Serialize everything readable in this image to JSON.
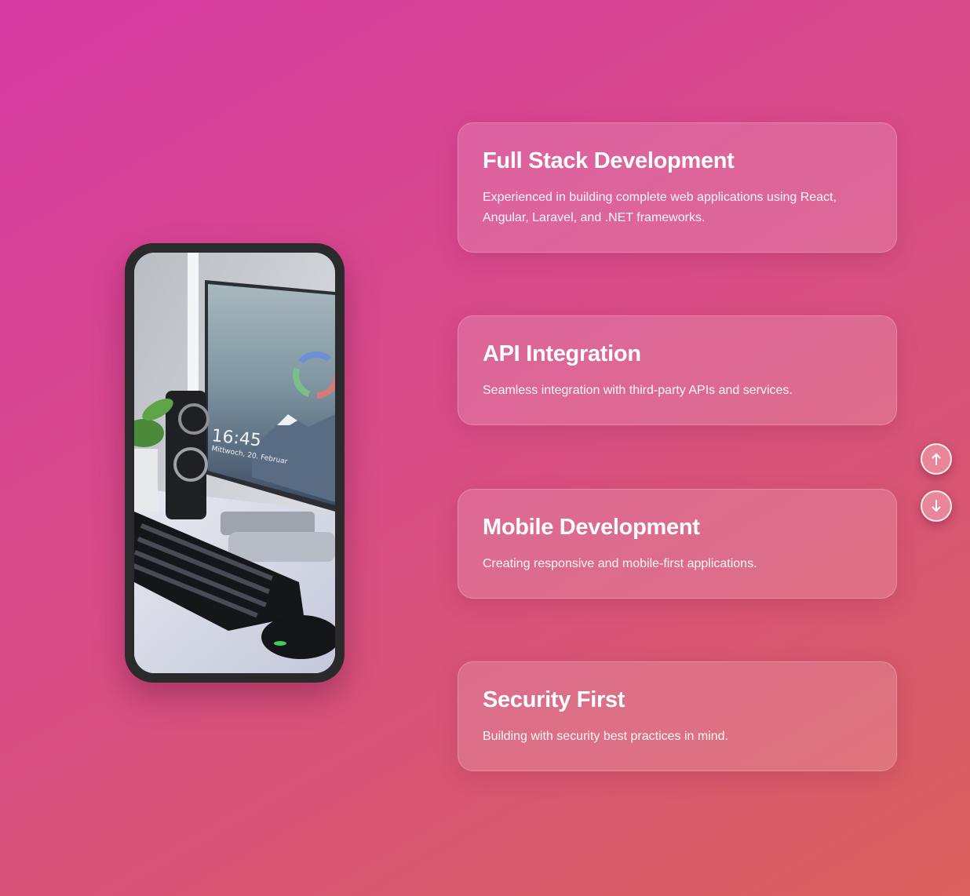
{
  "phone": {
    "image_description_icon": "desk-setup-photo",
    "clock_time": "16:45",
    "clock_date": "Mittwoch, 20. Februar"
  },
  "cards": [
    {
      "title": "Full Stack Development",
      "description": "Experienced in building complete web applications using React, Angular, Laravel, and .NET frameworks."
    },
    {
      "title": "API Integration",
      "description": "Seamless integration with third-party APIs and services."
    },
    {
      "title": "Mobile Development",
      "description": "Creating responsive and mobile-first applications."
    },
    {
      "title": "Security First",
      "description": "Building with security best practices in mind."
    }
  ],
  "nav": {
    "up_icon": "arrow-up-icon",
    "down_icon": "arrow-down-icon"
  },
  "colors": {
    "gradient_start": "#d63aa2",
    "gradient_end": "#d9605c",
    "phone_frame": "#2a2a2c"
  }
}
